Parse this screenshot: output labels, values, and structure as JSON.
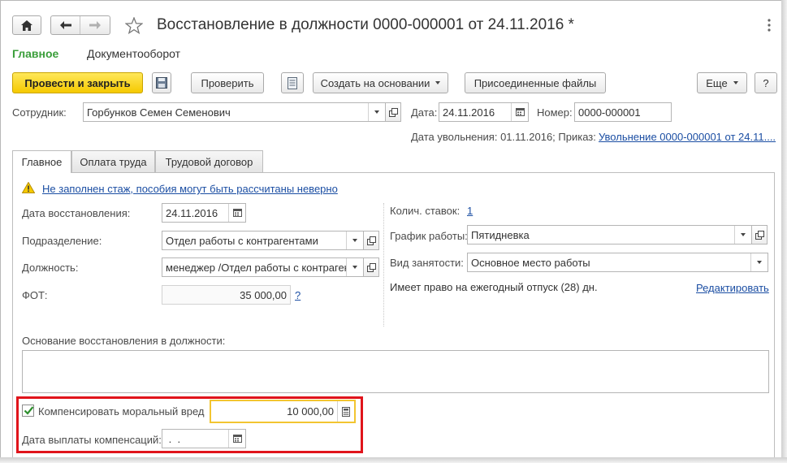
{
  "window": {
    "title": "Восстановление в должности 0000-000001 от 24.11.2016 *",
    "icons": [
      "home-icon",
      "arrow-left-icon",
      "arrow-right-icon",
      "star-icon",
      "kebab-menu-icon"
    ]
  },
  "nav": {
    "main_label": "Главное",
    "docflow_label": "Документооборот"
  },
  "toolbar": {
    "post_close_label": "Провести и закрыть",
    "check_label": "Проверить",
    "create_based_label": "Создать на основании",
    "attached_files_label": "Присоединенные файлы",
    "more_label": "Еще",
    "help_label": "?"
  },
  "header": {
    "employee_label": "Сотрудник:",
    "employee_value": "Горбунков Семен Семенович",
    "date_label": "Дата:",
    "date_value": "24.11.2016",
    "number_label": "Номер:",
    "number_value": "0000-000001",
    "dismissal_info": "Дата увольнения: 01.11.2016; Приказ:",
    "dismissal_link": "Увольнение 0000-000001 от 24.11...."
  },
  "tabs": [
    {
      "label": "Главное"
    },
    {
      "label": "Оплата труда"
    },
    {
      "label": "Трудовой договор"
    }
  ],
  "main": {
    "warning_link": "Не заполнен стаж, пособия могут быть рассчитаны неверно",
    "restore_date_label": "Дата восстановления:",
    "restore_date_value": "24.11.2016",
    "department_label": "Подразделение:",
    "department_value": "Отдел работы с контрагентами",
    "position_label": "Должность:",
    "position_value": "менеджер /Отдел работы с контрагент",
    "fot_label": "ФОТ:",
    "fot_value": "35 000,00",
    "fot_help": "?",
    "rates_label": "Колич. ставок:",
    "rates_value": "1",
    "schedule_label": "График работы:",
    "schedule_value": "Пятидневка",
    "employment_label": "Вид занятости:",
    "employment_value": "Основное место работы",
    "vacation_text": "Имеет право на ежегодный отпуск (28) дн.",
    "edit_link": "Редактировать",
    "basis_label": "Основание восстановления в должности:",
    "basis_value": "",
    "compensate_label": "Компенсировать моральный вред",
    "compensate_checked": true,
    "compensate_value": "10 000,00",
    "payment_date_label": "Дата выплаты компенсаций:",
    "payment_date_value": " .  ."
  },
  "colors": {
    "accent_green": "#3a9e3a",
    "post_button_yellow": "#f7d117",
    "highlight_red": "#e0141b",
    "link_blue": "#1b4ea3"
  }
}
